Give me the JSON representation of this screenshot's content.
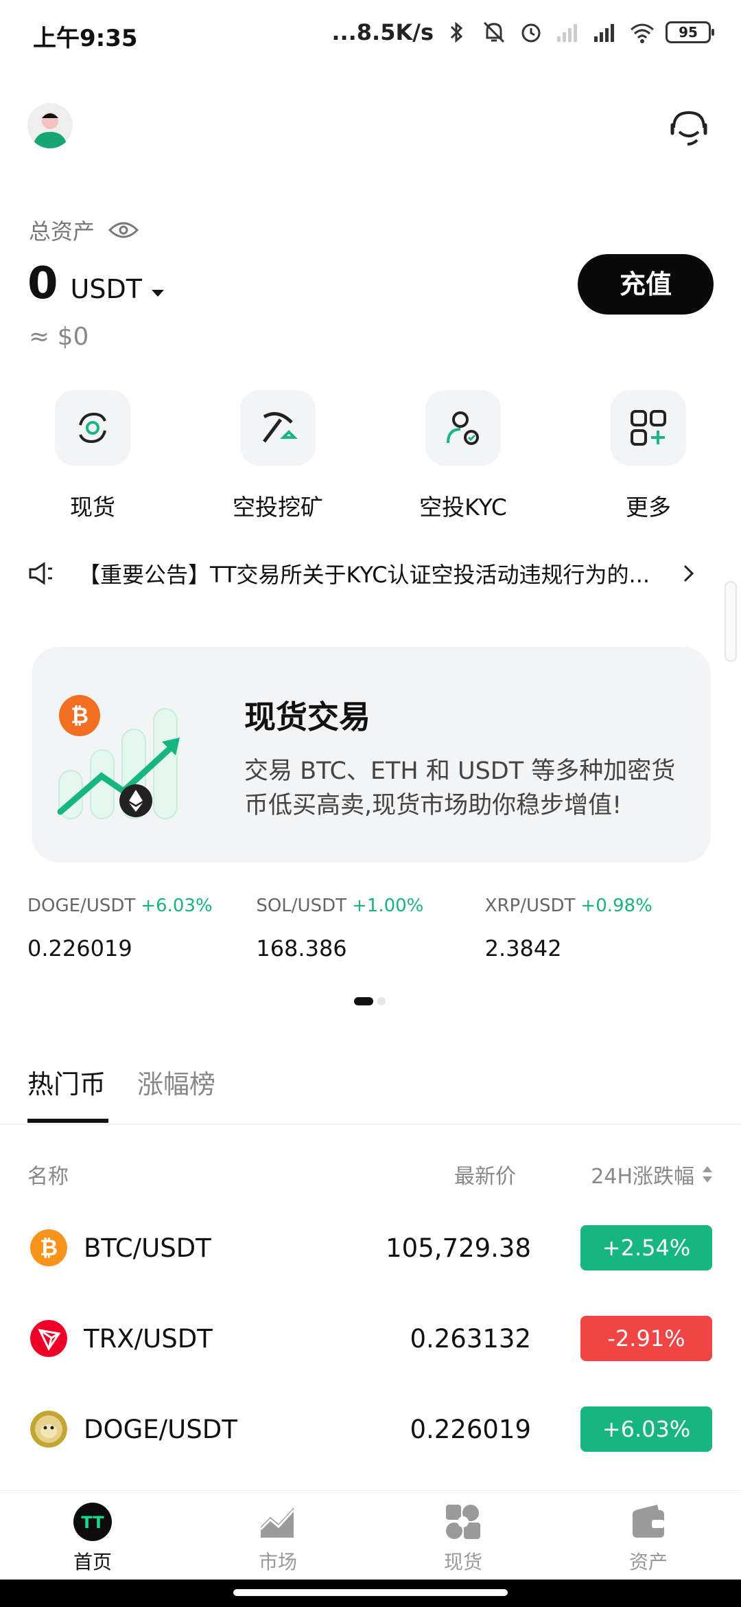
{
  "status_bar": {
    "time": "上午9:35",
    "network_speed": "...8.5K/s",
    "battery": "95",
    "icons": [
      "bluetooth-icon",
      "mute-bell-icon",
      "alarm-icon",
      "signal-icon",
      "hd-signal-icon",
      "wifi-icon"
    ]
  },
  "header": {
    "avatar": "avatar",
    "support_icon": "customer-service-icon"
  },
  "assets": {
    "label": "总资产",
    "value": "0",
    "unit": "USDT",
    "approx": "≈ $0",
    "deposit_label": "充值"
  },
  "quick_actions": [
    {
      "label": "现货",
      "icon": "spot-icon"
    },
    {
      "label": "空投挖矿",
      "icon": "pickaxe-icon"
    },
    {
      "label": "空投KYC",
      "icon": "user-check-icon"
    },
    {
      "label": "更多",
      "icon": "more-grid-icon"
    }
  ],
  "announcement": {
    "text": "【重要公告】TT交易所关于KYC认证空投活动违规行为的..."
  },
  "banner": {
    "title": "现货交易",
    "description": "交易 BTC、ETH 和 USDT 等多种加密货币低买高卖,现货市场助你稳步增值!"
  },
  "tickers": [
    {
      "pair": "DOGE/USDT",
      "change": "+6.03%",
      "price": "0.226019"
    },
    {
      "pair": "SOL/USDT",
      "change": "+1.00%",
      "price": "168.386"
    },
    {
      "pair": "XRP/USDT",
      "change": "+0.98%",
      "price": "2.3842"
    }
  ],
  "tabs": [
    {
      "label": "热门币",
      "active": true
    },
    {
      "label": "涨幅榜",
      "active": false
    }
  ],
  "table": {
    "headers": {
      "name": "名称",
      "price": "最新价",
      "change": "24H涨跌幅"
    },
    "rows": [
      {
        "pair": "BTC/USDT",
        "price": "105,729.38",
        "change": "+2.54%",
        "direction": "up",
        "icon": "btc-icon"
      },
      {
        "pair": "TRX/USDT",
        "price": "0.263132",
        "change": "-2.91%",
        "direction": "down",
        "icon": "trx-icon"
      },
      {
        "pair": "DOGE/USDT",
        "price": "0.226019",
        "change": "+6.03%",
        "direction": "up",
        "icon": "doge-icon"
      }
    ]
  },
  "bottom_nav": [
    {
      "label": "首页",
      "icon": "home-tt-icon",
      "active": true
    },
    {
      "label": "市场",
      "icon": "market-chart-icon",
      "active": false
    },
    {
      "label": "现货",
      "icon": "spot-nav-icon",
      "active": false
    },
    {
      "label": "资产",
      "icon": "wallet-icon",
      "active": false
    }
  ],
  "colors": {
    "up": "#17b57f",
    "down": "#f04545",
    "accent": "#111111",
    "icon_green": "#19b585"
  }
}
